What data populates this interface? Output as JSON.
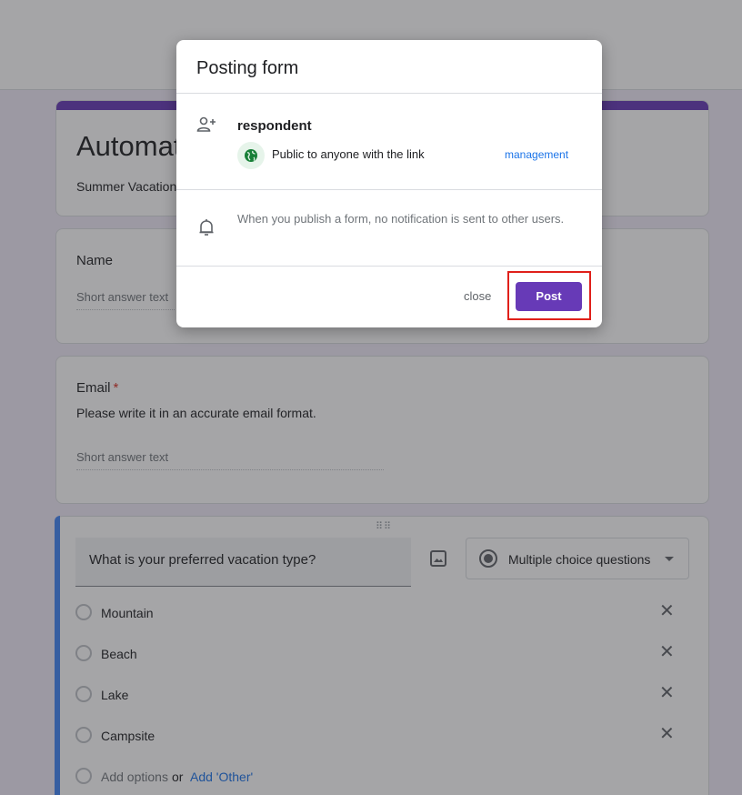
{
  "form": {
    "title": "Automat",
    "description": "Summer Vacation",
    "questions": {
      "name": {
        "label": "Name",
        "placeholder": "Short answer text"
      },
      "email": {
        "label": "Email",
        "required_mark": "*",
        "help": "Please write it in an accurate email format.",
        "placeholder": "Short answer text"
      },
      "vacation": {
        "question": "What is your preferred vacation type?",
        "type_label": "Multiple choice questions",
        "options": [
          "Mountain",
          "Beach",
          "Lake",
          "Campsite"
        ],
        "add_option": "Add options",
        "or": "or",
        "add_other": "Add 'Other'",
        "remove_glyph": "✕",
        "drag_glyph": "⠿⠿"
      }
    }
  },
  "dialog": {
    "title": "Posting form",
    "respondent_title": "respondent",
    "access_text": "Public to anyone with the link",
    "management_label": "management",
    "notice": "When you publish a form, no notification is sent to other users.",
    "close_label": "close",
    "post_label": "Post"
  },
  "colors": {
    "accent_purple": "#673ab7",
    "link_blue": "#1a73e8",
    "focus_blue": "#4285f4",
    "highlight_red": "#e0201a"
  }
}
